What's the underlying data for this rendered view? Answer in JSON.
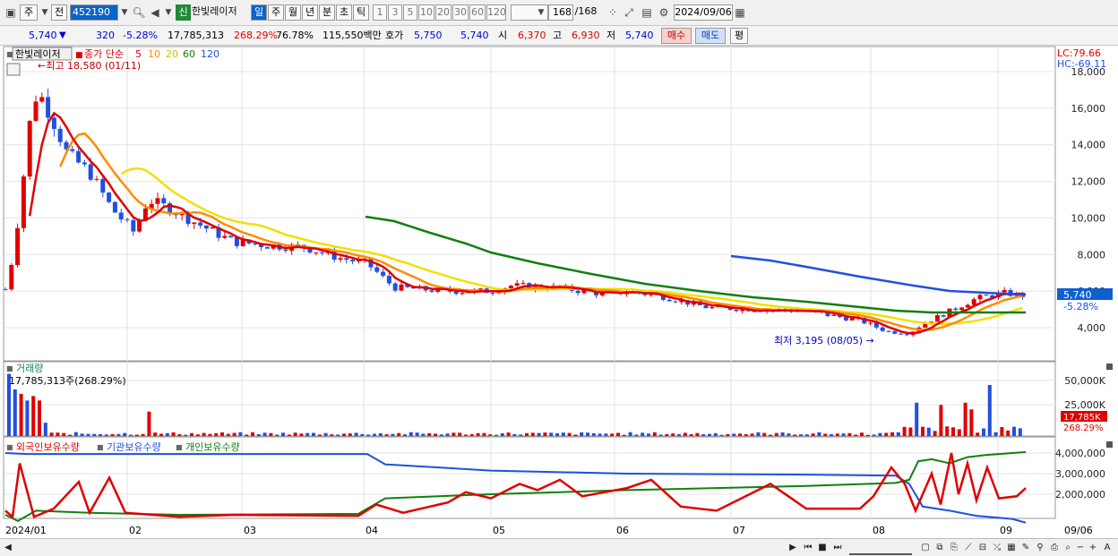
{
  "toolbar": {
    "type_label": "주",
    "prev_label": "전",
    "code": "452190",
    "badge": "신",
    "name": "한빛레이저",
    "periods": [
      "일",
      "주",
      "월",
      "년",
      "분",
      "초",
      "틱"
    ],
    "active_period": "일",
    "intervals": [
      "1",
      "3",
      "5",
      "10",
      "20",
      "30",
      "60",
      "120"
    ],
    "count_current": "168",
    "count_total": "/168",
    "date": "2024/09/06"
  },
  "quote": {
    "price": "5,740",
    "direction_icon": "▼",
    "change": "320",
    "change_pct": "-5.28%",
    "volume": "17,785,313",
    "volume_ratio": "268.29%",
    "turnover": "76.78%",
    "amount": "115,550백만",
    "hoga_label": "호가",
    "ask": "5,750",
    "bid": "5,740",
    "open_label": "시",
    "open": "6,370",
    "high_label": "고",
    "high": "6,930",
    "low_label": "저",
    "low": "5,740",
    "buy_button": "매수",
    "sell_button": "매도",
    "eval_button": "평"
  },
  "price_panel": {
    "name_tag": "한빛레이저",
    "ma_legend_title": "종가 단순",
    "ma_periods": [
      "5",
      "10",
      "20",
      "60",
      "120"
    ],
    "ma_colors": [
      "#e00000",
      "#ff8c00",
      "#f0e000",
      "#108010",
      "#2050e0"
    ],
    "high_marker": "←최고 18,580 (01/11)",
    "low_marker": "최저 3,195 (08/05) →",
    "lc_label": "LC:79.66",
    "hc_label": "HC:-69.11",
    "y_ticks": [
      "18,000",
      "16,000",
      "14,000",
      "12,000",
      "10,000",
      "8,000",
      "6,000",
      "4,000"
    ],
    "current_price_tag": "5,740",
    "current_change_tag": "-5.28%"
  },
  "volume_panel": {
    "title": "거래량",
    "subtitle": "17,785,313주(268.29%)",
    "y_ticks": [
      "50,000K",
      "25,000K"
    ],
    "current_tag": "17,785K",
    "current_pct_tag": "268.29%"
  },
  "holdings_panel": {
    "legend": [
      "외국인보유수량",
      "기관보유수량",
      "개인보유수량"
    ],
    "legend_colors": [
      "#e00000",
      "#2050e0",
      "#108010"
    ],
    "y_ticks": [
      "4,000,000",
      "3,000,000",
      "2,000,000"
    ]
  },
  "x_axis": {
    "labels": [
      "2024/01",
      "02",
      "03",
      "04",
      "05",
      "06",
      "07",
      "08",
      "09"
    ],
    "last_date": "09/06"
  },
  "colors": {
    "up": "#e00000",
    "down": "#2050e0",
    "accent": "#0a64c8"
  }
}
